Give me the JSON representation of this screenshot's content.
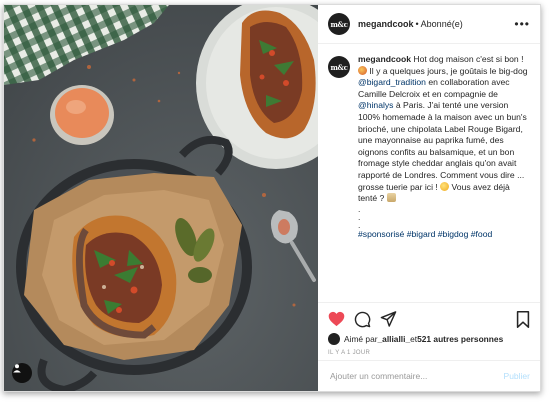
{
  "post": {
    "username": "megandcook",
    "separator": "•",
    "follow_status": "Abonné(e)",
    "avatar_text": "m&c",
    "caption": {
      "username": "megandcook",
      "p1": " Hot dog maison c'est si bon ! ",
      "p2": " Il y a quelques jours, je goûtais le big-dog ",
      "mention1": "@bigard_tradition",
      "p3": " en collaboration avec Camille Delcroix et en compagnie de ",
      "mention2": "@hinalys",
      "p4": " à Paris. J'ai tenté une version 100% homemade à la maison avec un bun's brioché, une chipolata Label Rouge Bigard, une mayonnaise au paprika fumé, des oignons confits au balsamique, et un bon fromage style cheddar anglais qu'on avait rapporté de Londres. Comment vous dire ... grosse tuerie par ici ! ",
      "p5": " Vous avez déjà tenté ? ",
      "dots": [
        ".",
        ".",
        "."
      ],
      "hashtags": "#sponsorisé #bigard #bigdog #food"
    },
    "likes": {
      "prefix": "Aimé par ",
      "user": "_allialli_",
      "middle": " et ",
      "count": "521 autres personnes"
    },
    "time": "IL Y A 1 JOUR",
    "comment_placeholder": "Ajouter un commentaire...",
    "publish_label": "Publier"
  },
  "icons": [
    "heart-icon",
    "comment-icon",
    "share-icon",
    "bookmark-icon",
    "more-icon",
    "user-tag-icon"
  ],
  "colors": {
    "heart": "#ed4956",
    "link": "#003569",
    "publish": "#b2dffc"
  }
}
